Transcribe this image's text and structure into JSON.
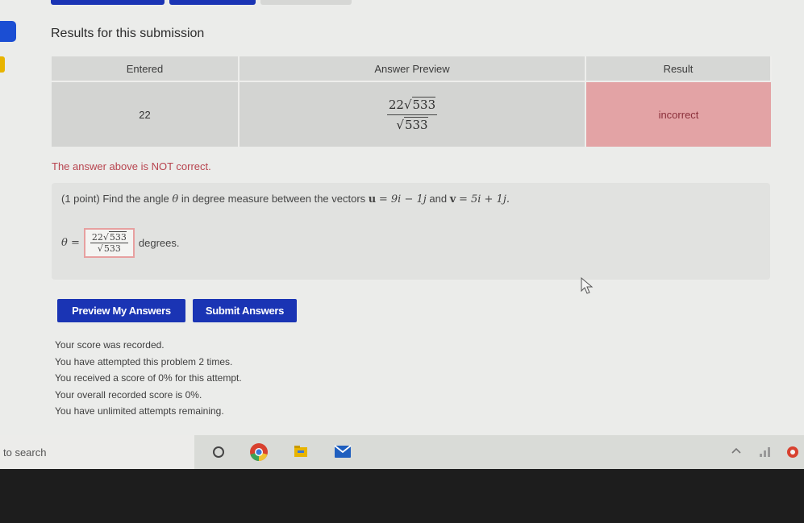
{
  "results": {
    "title": "Results for this submission",
    "headers": [
      "Entered",
      "Answer Preview",
      "Result"
    ],
    "row": {
      "entered": "22",
      "preview_num_coef": "22",
      "preview_num_rad": "533",
      "preview_den_rad": "533",
      "result": "incorrect"
    }
  },
  "feedback": "The answer above is NOT correct.",
  "problem": {
    "points": "(1 point)",
    "text_before": "Find the angle",
    "theta": "θ",
    "text_mid": "in degree measure between the vectors",
    "u_name": "u",
    "u_expr": "= 9i − 1j",
    "and": "and",
    "v_name": "v",
    "v_expr": "= 5i + 1j.",
    "theta_eq": "θ =",
    "answer_num_coef": "22",
    "answer_num_rad": "533",
    "answer_den_rad": "533",
    "unit": "degrees."
  },
  "buttons": {
    "preview": "Preview My Answers",
    "submit": "Submit Answers"
  },
  "status_lines": [
    "Your score was recorded.",
    "You have attempted this problem 2 times.",
    "You received a score of 0% for this attempt.",
    "Your overall recorded score is 0%.",
    "You have unlimited attempts remaining."
  ],
  "taskbar": {
    "search_placeholder": "to search",
    "icons": [
      "cortana-circle-icon",
      "chrome-icon",
      "file-explorer-icon",
      "mail-icon",
      "chevron-up-icon",
      "network-icon",
      "notification-icon"
    ]
  },
  "colors": {
    "button_blue": "#1a34b4",
    "incorrect_bg": "#e3a3a5",
    "error_text": "#b7434e"
  }
}
